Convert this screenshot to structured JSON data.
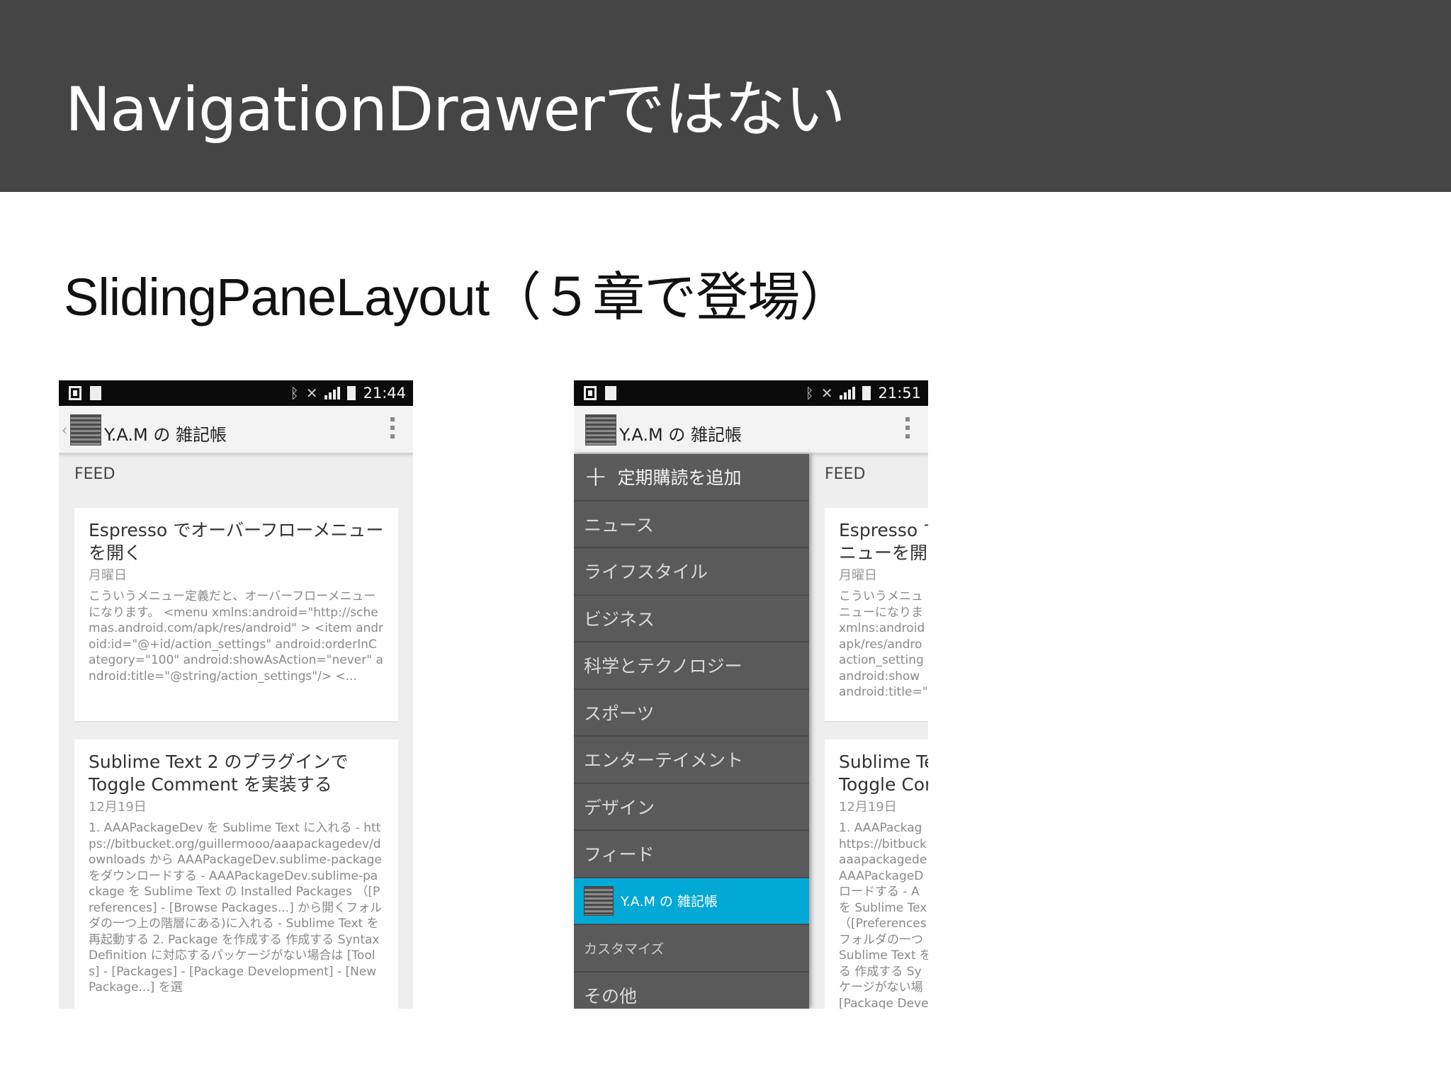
{
  "slide": {
    "title": "NavigationDrawerではない",
    "subtitle": "SlidingPaneLayout（５章で登場）"
  },
  "colors": {
    "header_bg": "#454545",
    "drawer_bg": "#5a5a5a",
    "drawer_selected": "#03a9d6"
  },
  "left_phone": {
    "status_time": "21:44",
    "app_title": "Y.A.M の 雑記帳",
    "feed_label": "FEED",
    "cards": [
      {
        "title": "Espresso でオーバーフローメニューを開く",
        "date": "月曜日",
        "body": "こういうメニュー定義だと、オーバーフローメニューになります。 <menu xmlns:android=\"http://schemas.android.com/apk/res/android\" > <item android:id=\"@+id/action_settings\" android:orderInCategory=\"100\" android:showAsAction=\"never\" android:title=\"@string/action_settings\"/> <..."
      },
      {
        "title": "Sublime Text 2 のプラグインで Toggle Comment を実装する",
        "date": "12月19日",
        "body": "1. AAAPackageDev を Sublime Text に入れる - https://bitbucket.org/guillermooo/aaapackagedev/downloads から AAAPackageDev.sublime-package をダウンロードする - AAAPackageDev.sublime-package を Sublime Text の Installed Packages （[Preferences] - [Browse Packages...] から開くフォルダの一つ上の階層にある)に入れる - Sublime Text を再起動する 2. Package を作成する 作成する Syntax Definition に対応するパッケージがない場合は [Tools] - [Packages] - [Package Development] - [New Package...] を選"
      }
    ]
  },
  "right_phone": {
    "status_time": "21:51",
    "app_title": "Y.A.M の 雑記帳",
    "feed_label": "FEED",
    "drawer": {
      "add_label": "定期購読を追加",
      "items": [
        "ニュース",
        "ライフスタイル",
        "ビジネス",
        "科学とテクノロジー",
        "スポーツ",
        "エンターテイメント",
        "デザイン",
        "フィード"
      ],
      "selected": "Y.A.M の 雑記帳",
      "customize": "カスタマイズ",
      "other": "その他"
    },
    "cards": [
      {
        "title_l1": "Espresso で",
        "title_l2": "ニューを開",
        "date": "月曜日",
        "body_lines": [
          "こういうメニュ",
          "ニューになりま",
          "xmlns:android",
          "apk/res/andro",
          "action_setting",
          "android:show",
          "android:title=\"("
        ]
      },
      {
        "title_l1": "Sublime Te",
        "title_l2": "Toggle Cor",
        "date": "12月19日",
        "body_lines": [
          "1. AAAPackag",
          "https://bitbuck",
          "aaapackagede",
          "AAAPackageD",
          "ロードする - A",
          "を Sublime Tex",
          "（[Preferences",
          "フォルダの一つ",
          "Sublime Text を",
          "る 作成する Sy",
          "ケージがない場",
          "[Package Deve"
        ]
      }
    ]
  }
}
